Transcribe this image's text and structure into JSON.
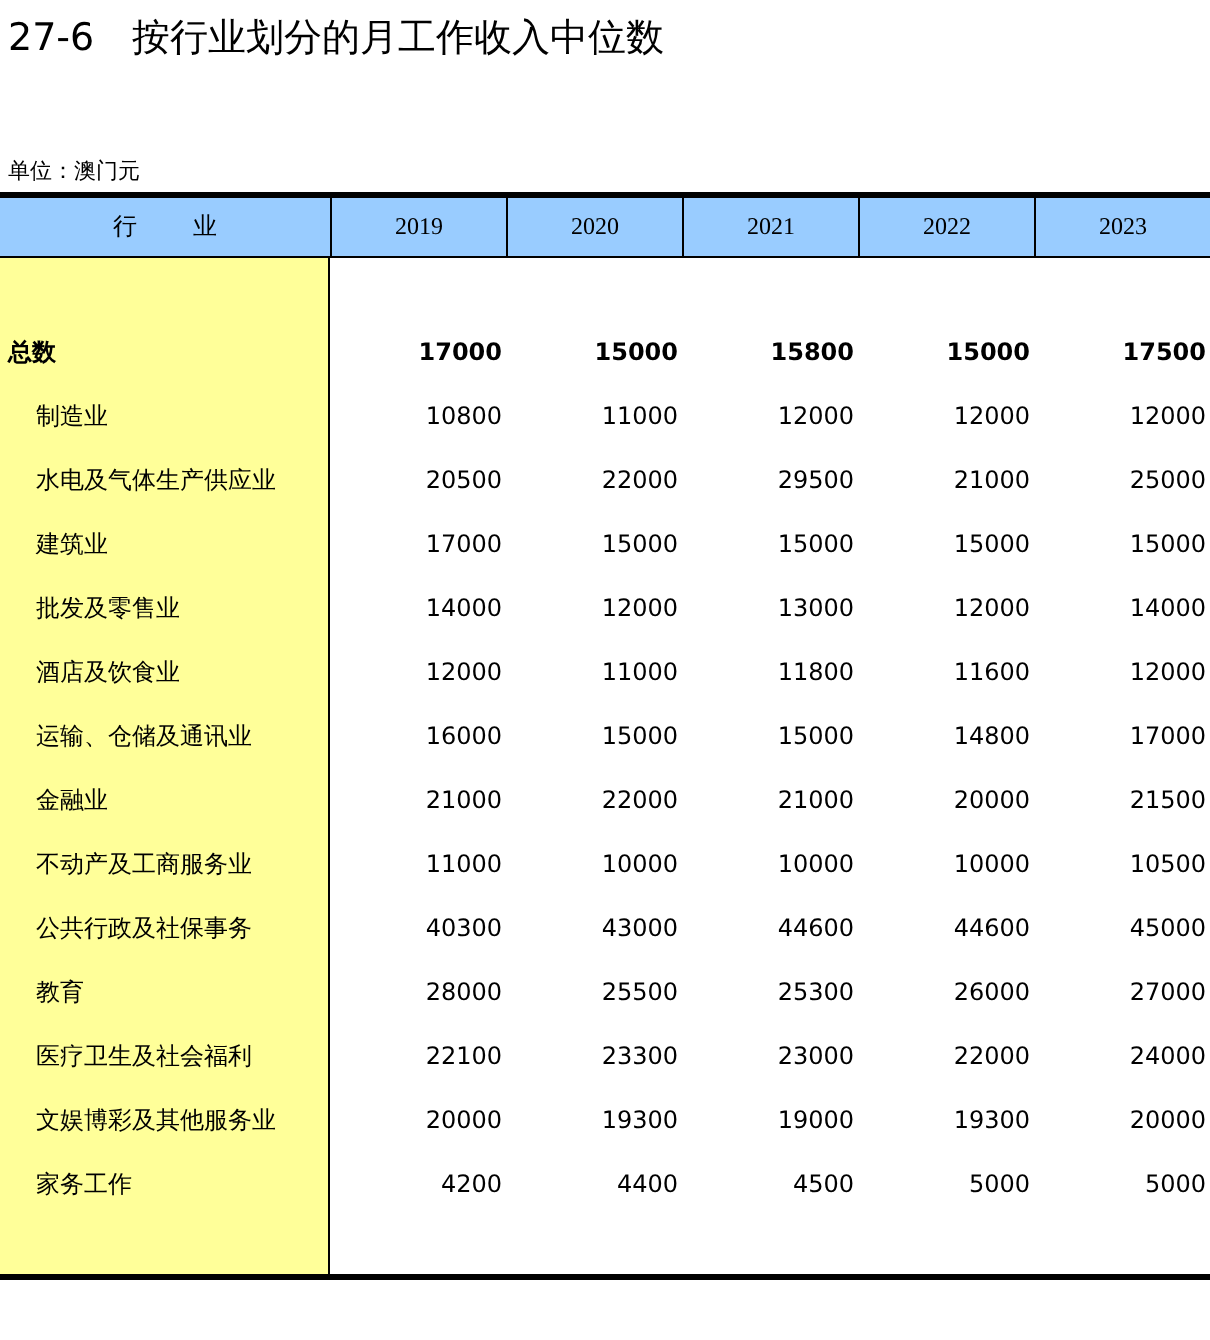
{
  "title": "27-6　按行业划分的月工作收入中位数",
  "unit": "单位：澳门元",
  "table": {
    "columns": [
      "行 业",
      "2019",
      "2020",
      "2021",
      "2022",
      "2023"
    ],
    "rows": [
      {
        "kind": "total",
        "label": "总数",
        "values": [
          "17000",
          "15000",
          "15800",
          "15000",
          "17500"
        ]
      },
      {
        "kind": "item",
        "label": "制造业",
        "values": [
          "10800",
          "11000",
          "12000",
          "12000",
          "12000"
        ]
      },
      {
        "kind": "item",
        "label": "水电及气体生产供应业",
        "values": [
          "20500",
          "22000",
          "29500",
          "21000",
          "25000"
        ]
      },
      {
        "kind": "item",
        "label": "建筑业",
        "values": [
          "17000",
          "15000",
          "15000",
          "15000",
          "15000"
        ]
      },
      {
        "kind": "item",
        "label": "批发及零售业",
        "values": [
          "14000",
          "12000",
          "13000",
          "12000",
          "14000"
        ]
      },
      {
        "kind": "item",
        "label": "酒店及饮食业",
        "values": [
          "12000",
          "11000",
          "11800",
          "11600",
          "12000"
        ]
      },
      {
        "kind": "item",
        "label": "运输、仓储及通讯业",
        "values": [
          "16000",
          "15000",
          "15000",
          "14800",
          "17000"
        ]
      },
      {
        "kind": "item",
        "label": "金融业",
        "values": [
          "21000",
          "22000",
          "21000",
          "20000",
          "21500"
        ]
      },
      {
        "kind": "item",
        "label": "不动产及工商服务业",
        "values": [
          "11000",
          "10000",
          "10000",
          "10000",
          "10500"
        ]
      },
      {
        "kind": "item",
        "label": "公共行政及社保事务",
        "values": [
          "40300",
          "43000",
          "44600",
          "44600",
          "45000"
        ]
      },
      {
        "kind": "item",
        "label": "教育",
        "values": [
          "28000",
          "25500",
          "25300",
          "26000",
          "27000"
        ]
      },
      {
        "kind": "item",
        "label": "医疗卫生及社会福利",
        "values": [
          "22100",
          "23300",
          "23000",
          "22000",
          "24000"
        ]
      },
      {
        "kind": "item",
        "label": "文娱博彩及其他服务业",
        "values": [
          "20000",
          "19300",
          "19000",
          "19300",
          "20000"
        ]
      },
      {
        "kind": "item",
        "label": "家务工作",
        "values": [
          "4200",
          "4400",
          "4500",
          "5000",
          "5000"
        ]
      }
    ]
  }
}
